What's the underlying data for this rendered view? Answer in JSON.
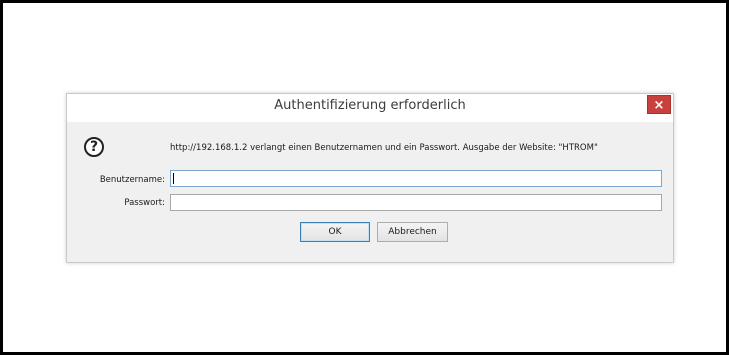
{
  "dialog": {
    "title": "Authentifizierung erforderlich",
    "close_label": "×",
    "icon": "question-circle-icon",
    "message": "http://192.168.1.2 verlangt einen Benutzernamen und ein Passwort. Ausgabe der Website: \"HTROM\"",
    "username_label": "Benutzername:",
    "username_value": "",
    "password_label": "Passwort:",
    "password_value": "",
    "ok_label": "OK",
    "cancel_label": "Abbrechen"
  },
  "colors": {
    "close_button": "#c9413d",
    "focus_border": "#7fa8d1",
    "dialog_background": "#f0f0f0"
  }
}
